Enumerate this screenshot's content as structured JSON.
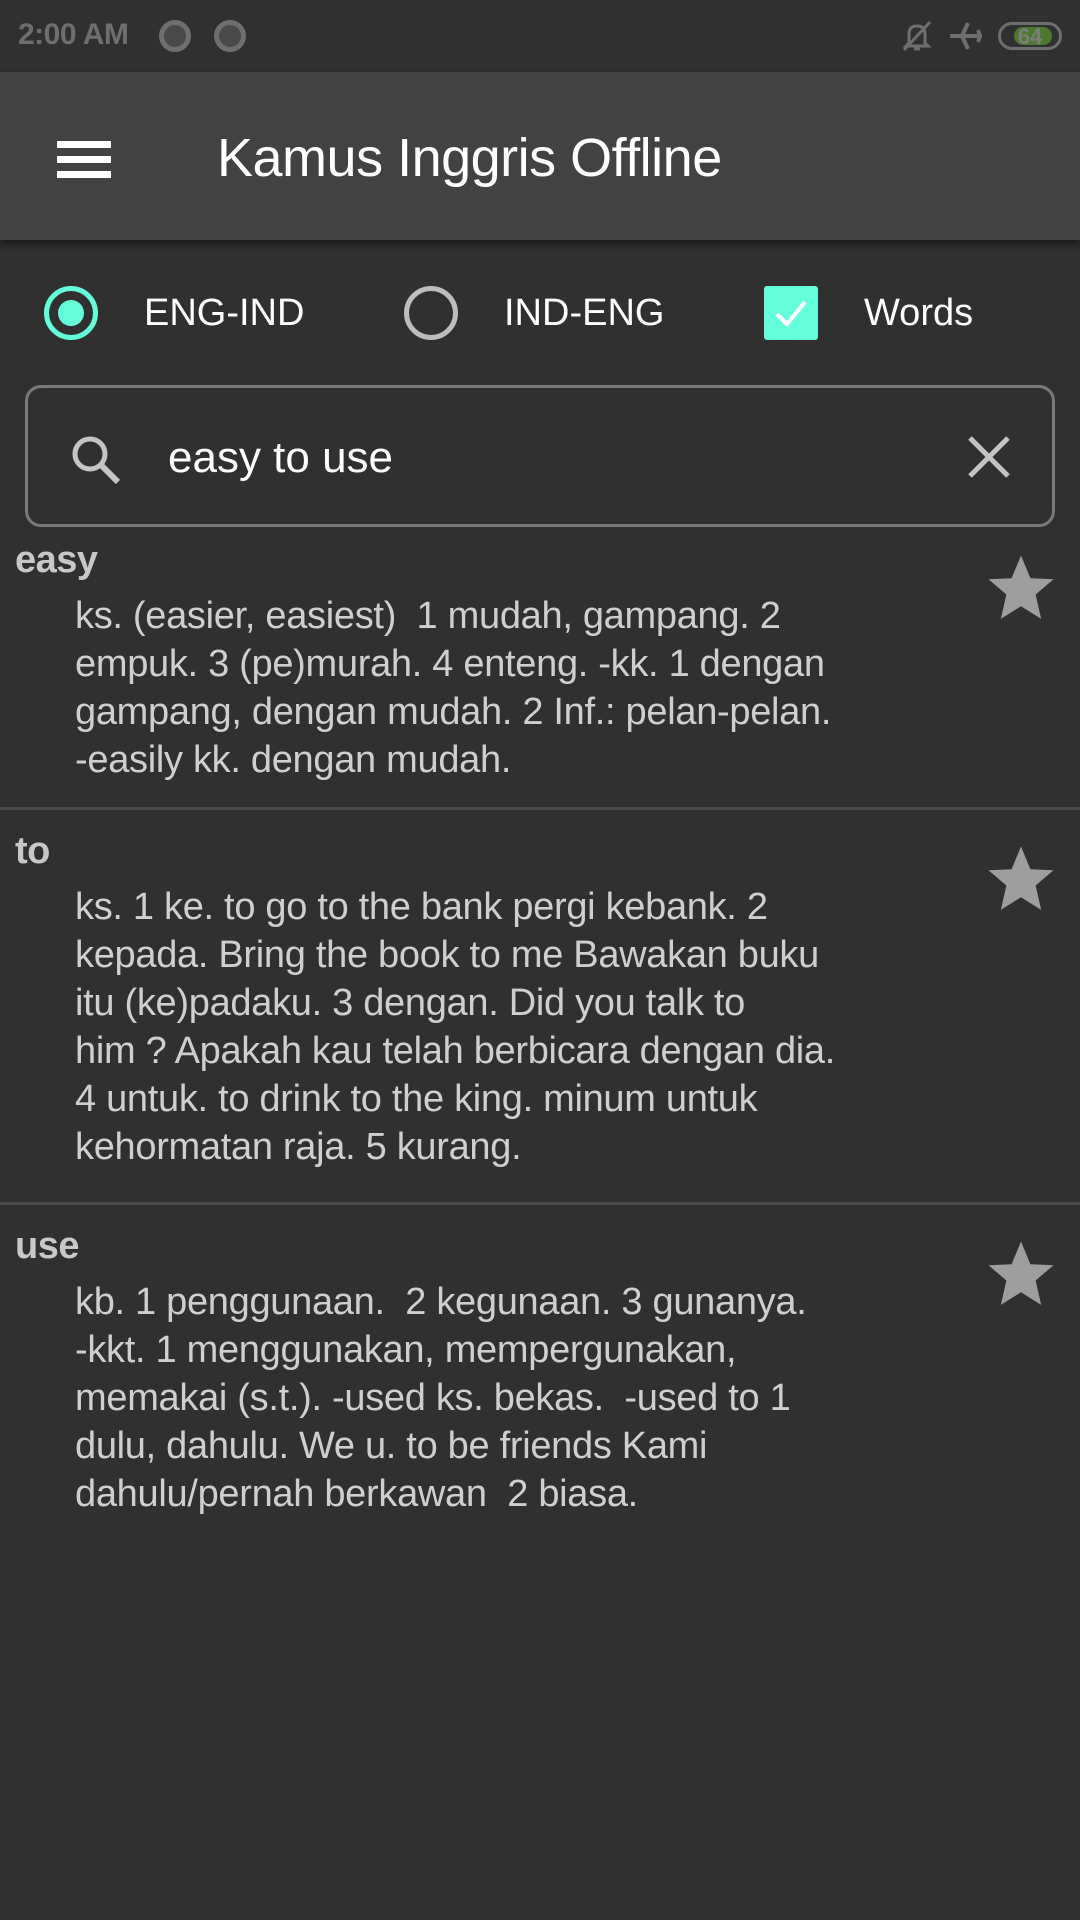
{
  "status_bar": {
    "time": "2:00 AM",
    "left_icons": [
      "notification-dot-icon",
      "notification-dot-icon"
    ],
    "right_icons": [
      "notifications-off-icon",
      "airplane-mode-icon",
      "battery-icon"
    ],
    "battery_level": "64",
    "battery_fraction": 0.64,
    "battery_color": "#4b7a2f"
  },
  "app_bar": {
    "menu_icon": "hamburger-menu-icon",
    "title": "Kamus Inggris Offline"
  },
  "options": {
    "accent_color": "#64ffda",
    "eng_ind": {
      "label": "ENG-IND",
      "checked": true
    },
    "ind_eng": {
      "label": "IND-ENG",
      "checked": false
    },
    "words": {
      "label": "Words",
      "checked": true
    }
  },
  "search": {
    "icon": "search-icon",
    "value": "easy to use",
    "clear_icon": "close-icon"
  },
  "results": [
    {
      "word": "easy",
      "definition": "ks. (easier, easiest)  1 mudah, gampang. 2\nempuk. 3 (pe)murah. 4 enteng. -kk. 1 dengan\ngampang, dengan mudah. 2 Inf.: pelan-pelan.\n-easily kk. dengan mudah.",
      "favorite_icon": "star-icon"
    },
    {
      "word": "to",
      "definition": "ks. 1 ke. to go to the bank pergi kebank. 2\nkepada. Bring the book to me Bawakan buku\nitu (ke)padaku. 3 dengan. Did you talk to\nhim ? Apakah kau telah berbicara dengan dia.\n4 untuk. to drink to the king. minum untuk\nkehormatan raja. 5 kurang.",
      "favorite_icon": "star-icon"
    },
    {
      "word": "use",
      "definition": "kb. 1 penggunaan.  2 kegunaan. 3 gunanya.\n-kkt. 1 menggunakan, mempergunakan,\nmemakai (s.t.). -used ks. bekas.  -used to 1\ndulu, dahulu. We u. to be friends Kami\ndahulu/pernah berkawan  2 biasa.",
      "favorite_icon": "star-icon"
    }
  ]
}
